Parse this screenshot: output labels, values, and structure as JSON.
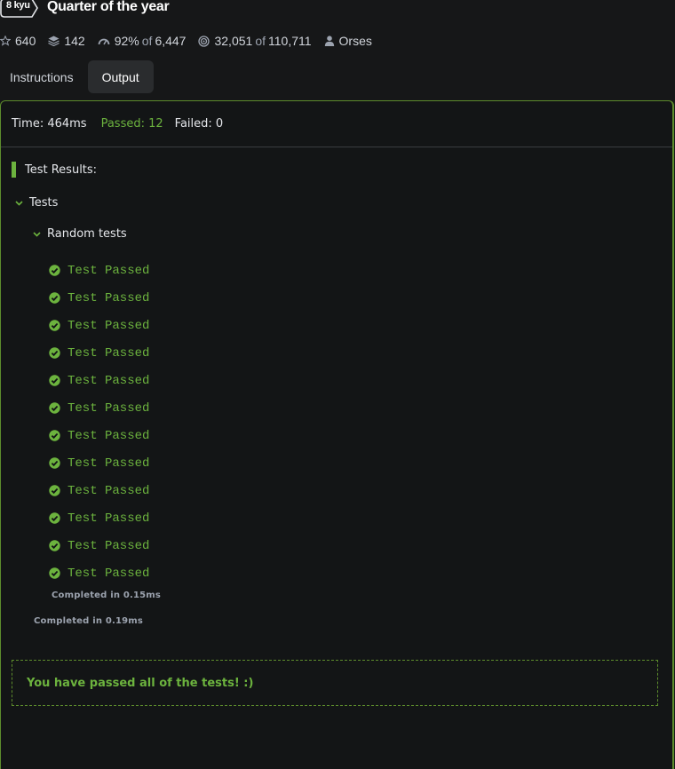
{
  "kata": {
    "rank": "8 kyu",
    "title": "Quarter of the year"
  },
  "stats": {
    "stars": "640",
    "collections": "142",
    "satisfaction": "92%",
    "satisfaction_of": "of",
    "satisfaction_votes": "6,447",
    "completed": "32,051",
    "completed_of": "of",
    "completed_attempts": "110,711",
    "author": "Orses"
  },
  "tabs": {
    "instructions": "Instructions",
    "output": "Output",
    "active": "output"
  },
  "summary": {
    "time": "Time: 464ms",
    "passed": "Passed: 12",
    "failed": "Failed: 0"
  },
  "results": {
    "heading": "Test Results:",
    "group": "Tests",
    "subgroup": "Random tests",
    "tests": [
      "Test Passed",
      "Test Passed",
      "Test Passed",
      "Test Passed",
      "Test Passed",
      "Test Passed",
      "Test Passed",
      "Test Passed",
      "Test Passed",
      "Test Passed",
      "Test Passed",
      "Test Passed"
    ],
    "subgroup_completed": "Completed in 0.15ms",
    "group_completed": "Completed in 0.19ms",
    "final_message": "You have passed all of the tests! :)"
  },
  "colors": {
    "accent_green": "#6cb33e",
    "border_green": "#5d8c2c",
    "background": "#161718"
  }
}
